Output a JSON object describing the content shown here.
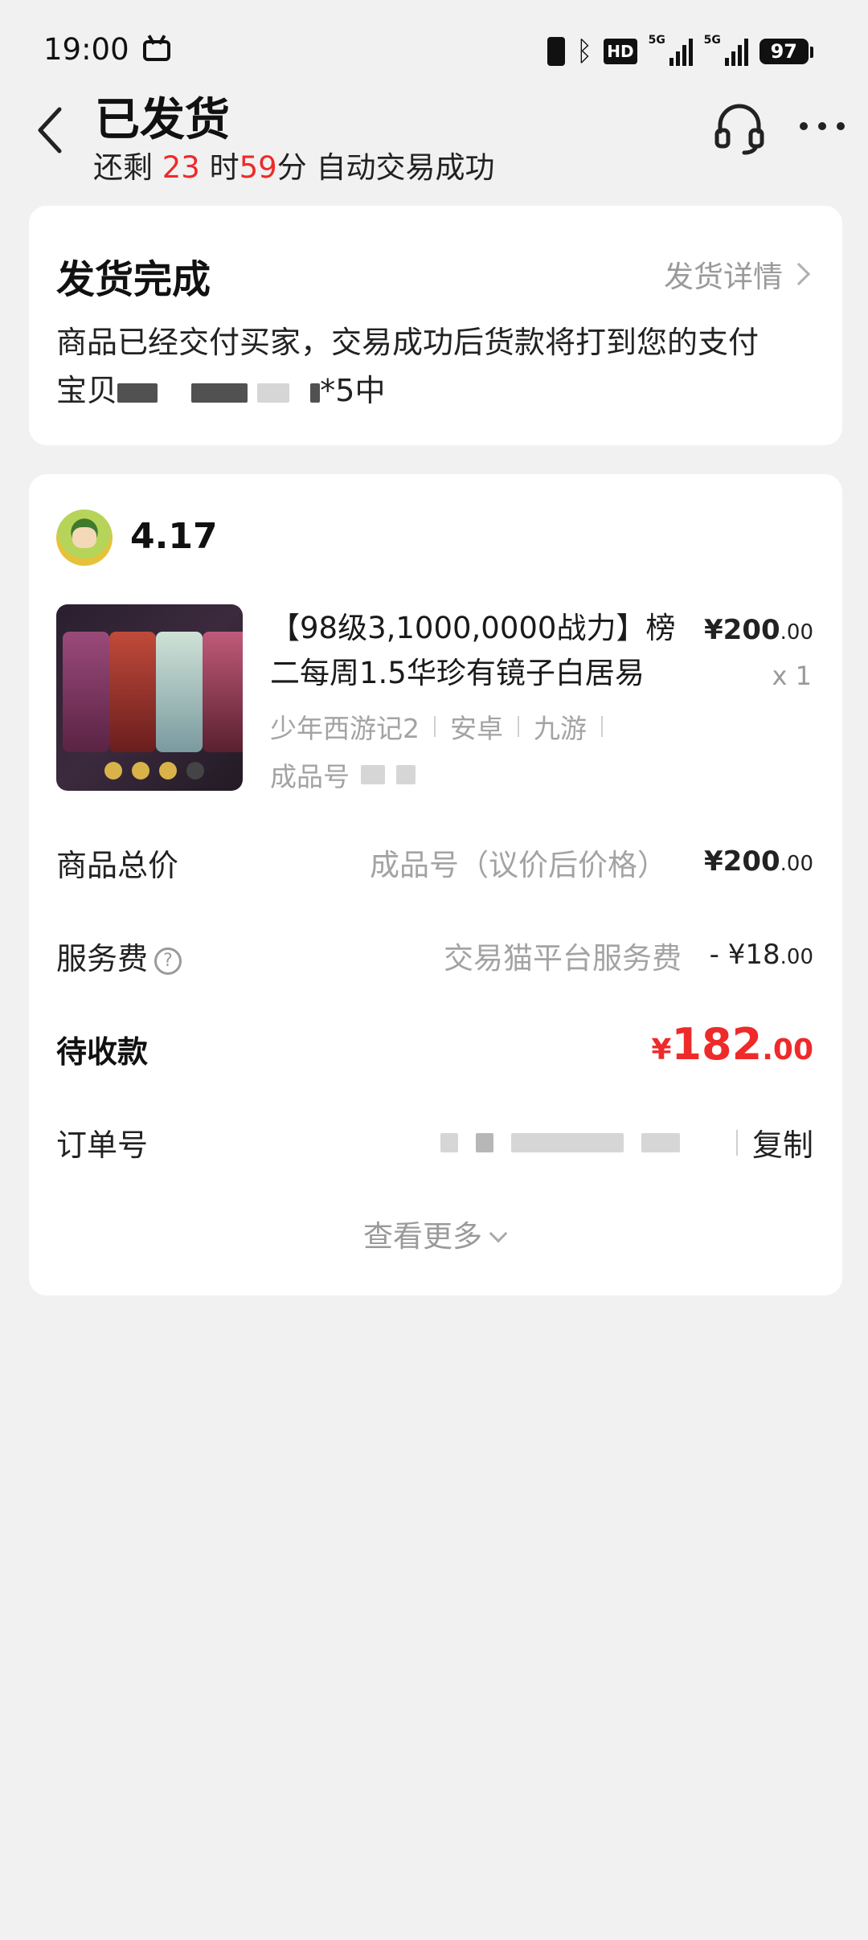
{
  "status_bar": {
    "time": "19:00",
    "hd_label": "HD",
    "sig1_label": "5G",
    "sig2_label": "5G",
    "battery": "97"
  },
  "header": {
    "title": "已发货",
    "countdown_prefix": "还剩 ",
    "hours": "23",
    "hours_unit": " 时",
    "minutes": "59",
    "minutes_unit": "分",
    "countdown_suffix": " 自动交易成功"
  },
  "delivery": {
    "title": "发货完成",
    "detail_link": "发货详情",
    "desc_line1": "商品已经交付买家，交易成功后货款将打到您的支付",
    "desc_line2_start": "宝贝",
    "desc_line2_end": "*5中"
  },
  "seller": {
    "rating": "4.17"
  },
  "item": {
    "title": "【98级3,1000,0000战力】榜二每周1.5华珍有镜子白居易",
    "price_int": "¥200",
    "price_dec": ".00",
    "qty": "x 1",
    "tags": [
      "少年西游记2",
      "安卓",
      "九游"
    ],
    "code_label": "成品号"
  },
  "rows": {
    "total_label": "商品总价",
    "total_note": "成品号（议价后价格）",
    "total_int": "¥200",
    "total_dec": ".00",
    "fee_label": "服务费",
    "fee_note": "交易猫平台服务费",
    "fee_int": "- ¥18",
    "fee_dec": ".00",
    "receivable_label": "待收款",
    "receivable_cur": "¥",
    "receivable_int": "182",
    "receivable_dec": ".00",
    "order_label": "订单号",
    "copy_label": "复制"
  },
  "view_more": "查看更多",
  "colors": {
    "accent_red": "#ee2a2a",
    "muted": "#9a9a9a",
    "background": "#f1f1f1"
  },
  "icons": [
    "back-arrow-icon",
    "headset-icon",
    "more-icon",
    "chevron-right-icon",
    "help-icon",
    "chevron-down-icon"
  ]
}
